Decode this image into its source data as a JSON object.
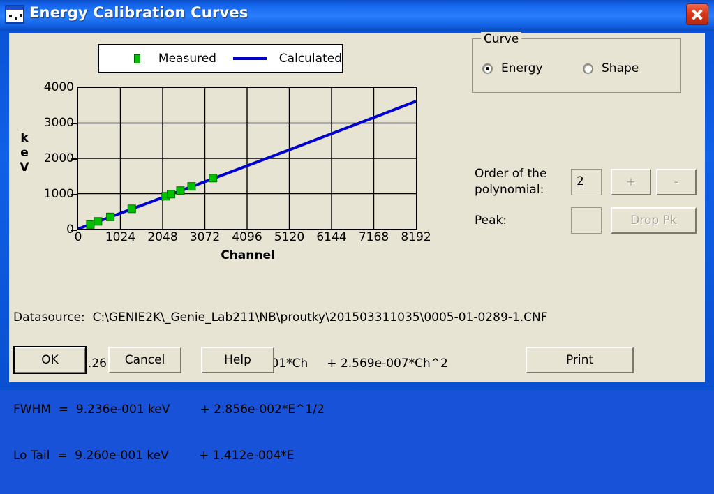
{
  "window": {
    "title": "Energy Calibration Curves",
    "icon": "spectrum-window-icon",
    "close_label": "×"
  },
  "legend": {
    "measured_label": "Measured",
    "calculated_label": "Calculated",
    "measured_color": "#00c000",
    "calculated_color": "#0000d0"
  },
  "curve_group": {
    "title": "Curve",
    "options": [
      {
        "label": "Energy",
        "selected": true
      },
      {
        "label": "Shape",
        "selected": false
      }
    ]
  },
  "polynomial": {
    "label_line1": "Order of the",
    "label_line2": "polynomial:",
    "value": "2",
    "plus_label": "+",
    "minus_label": "-",
    "peak_label": "Peak:",
    "peak_value": "",
    "drop_pk_label": "Drop Pk"
  },
  "info": {
    "datasource": "Datasource:  C:\\GENIE2K\\_Genie_Lab211\\NB\\proutky\\201503311035\\0005-01-0289-1.CNF",
    "energy": "Energy  = -3.261e-001 keV        + 4.345e-001*Ch     + 2.569e-007*Ch^2",
    "fwhm": "FWHM  =  9.236e-001 keV        + 2.856e-002*E^1/2",
    "lotail": "Lo Tail  =  9.260e-001 keV        + 1.412e-004*E"
  },
  "buttons": {
    "ok": "OK",
    "cancel": "Cancel",
    "help": "Help",
    "print": "Print"
  },
  "chart_data": {
    "type": "scatter",
    "title": "",
    "xlabel": "Channel",
    "ylabel": "keV",
    "xlim": [
      0,
      8192
    ],
    "ylim": [
      0,
      4000
    ],
    "xticks": [
      0,
      1024,
      2048,
      3072,
      4096,
      5120,
      6144,
      7168,
      8192
    ],
    "yticks": [
      0,
      1000,
      2000,
      3000,
      4000
    ],
    "grid": true,
    "legend_position": "above-plot",
    "series": [
      {
        "name": "Measured",
        "type": "scatter",
        "marker": "square",
        "color": "#00c000",
        "points": [
          [
            295,
            122
          ],
          [
            480,
            212
          ],
          [
            780,
            340
          ],
          [
            1300,
            568
          ],
          [
            2120,
            925
          ],
          [
            2250,
            985
          ],
          [
            2480,
            1085
          ],
          [
            2750,
            1205
          ],
          [
            3270,
            1440
          ]
        ]
      },
      {
        "name": "Calculated",
        "type": "line",
        "color": "#0000d0",
        "equation": "E = -3.261e-001 + 4.345e-001*Ch + 2.569e-007*Ch^2",
        "x_range": [
          0,
          8192
        ],
        "points": [
          [
            0,
            0
          ],
          [
            1024,
            443
          ],
          [
            2048,
            889
          ],
          [
            3072,
            1338
          ],
          [
            4096,
            1789
          ],
          [
            5120,
            2243
          ],
          [
            6144,
            2700
          ],
          [
            7168,
            3159
          ],
          [
            8192,
            3621
          ]
        ]
      }
    ]
  }
}
